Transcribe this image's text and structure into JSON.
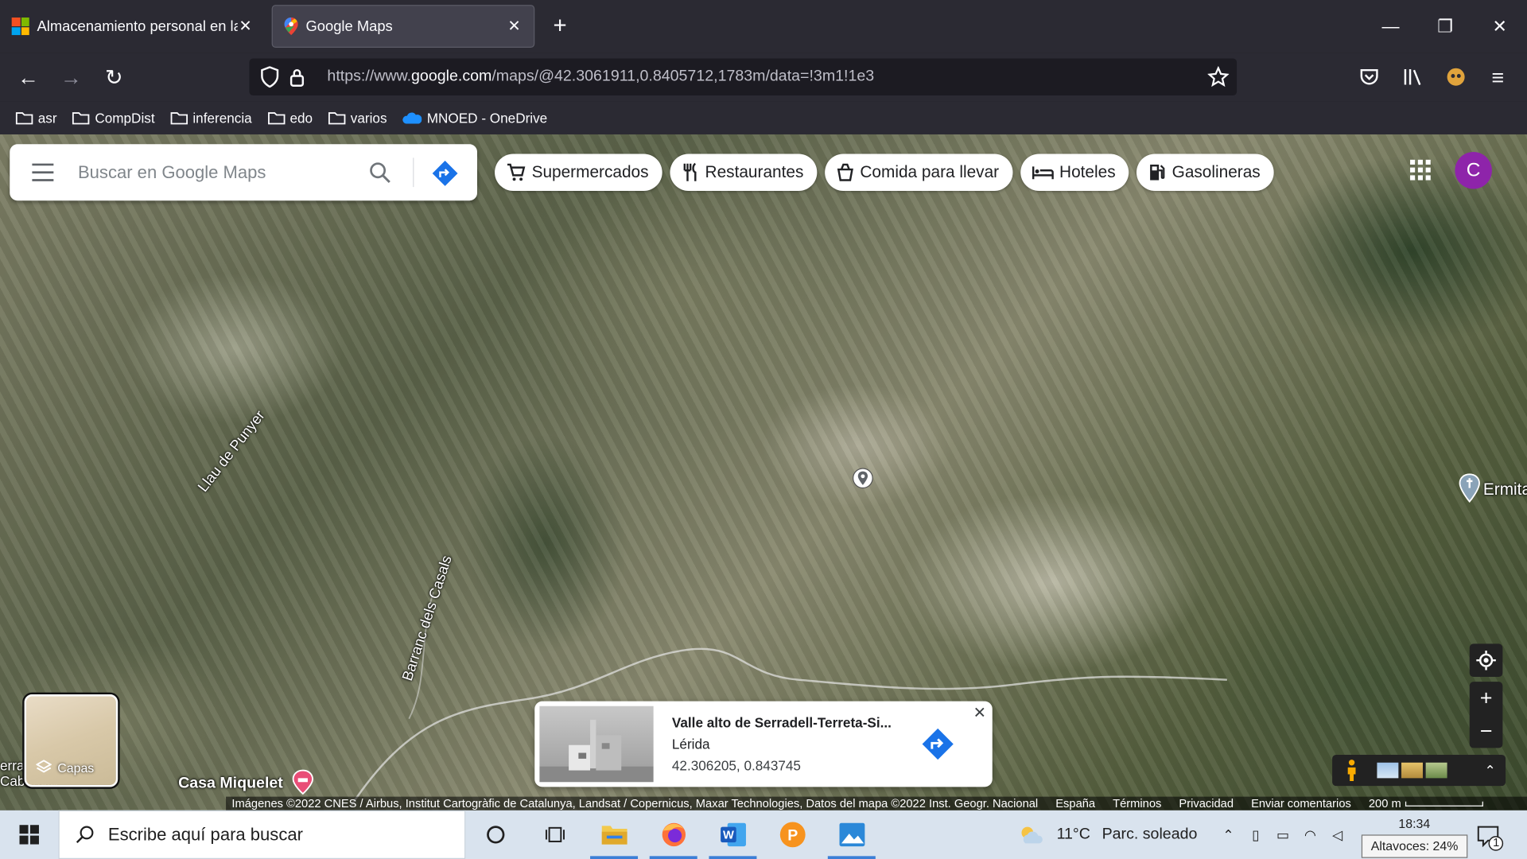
{
  "browser": {
    "tabs": [
      {
        "title": "Almacenamiento personal en la",
        "active": false
      },
      {
        "title": "Google Maps",
        "active": true
      }
    ],
    "url_prefix": "https://www.",
    "url_domain": "google.com",
    "url_rest": "/maps/@42.3061911,0.8405712,1783m/data=!3m1!1e3",
    "bookmarks": [
      "asr",
      "CompDist",
      "inferencia",
      "edo",
      "varios",
      "MNOED - OneDrive"
    ]
  },
  "maps": {
    "search_placeholder": "Buscar en Google Maps",
    "chips": [
      "Supermercados",
      "Restaurantes",
      "Comida para llevar",
      "Hoteles",
      "Gasolineras"
    ],
    "avatar_letter": "C",
    "labels": {
      "llau": "Llau de Punyer",
      "barranc": "Barranc dels Casals",
      "ermita": "Ermita",
      "casa": "Casa Miquelet",
      "left_edge": "erra\nCabancia"
    },
    "layers_label": "Capas",
    "place": {
      "title": "Valle alto de Serradell-Terreta-Si...",
      "region": "Lérida",
      "coords": "42.306205, 0.843745"
    },
    "attribution": "Imágenes ©2022 CNES / Airbus, Institut Cartogràfic de Catalunya, Landsat / Copernicus, Maxar Technologies, Datos del mapa ©2022 Inst. Geogr. Nacional",
    "footer_links": [
      "España",
      "Términos",
      "Privacidad",
      "Enviar comentarios"
    ],
    "scale": "200 m"
  },
  "taskbar": {
    "search_text": "Escribe aquí para buscar",
    "temperature": "11°C",
    "weather": "Parc. soleado",
    "time": "18:34",
    "tooltip": "Altavoces: 24%",
    "notification_count": "1"
  },
  "colors": {
    "browser_bg": "#2b2a33",
    "maps_blue": "#1a73e8",
    "avatar": "#8e24aa",
    "taskbar_bg": "#d9e3ee"
  }
}
